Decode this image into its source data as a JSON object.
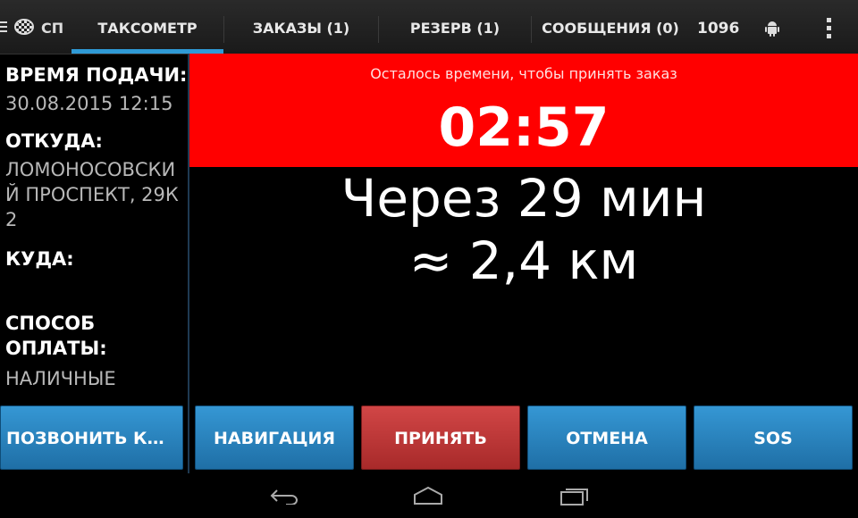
{
  "app": {
    "title": "СП"
  },
  "tabs": [
    {
      "label": "ТАКСОМЕТР",
      "active": true
    },
    {
      "label": "ЗАКАЗЫ (1)",
      "active": false
    },
    {
      "label": "РЕЗЕРВ (1)",
      "active": false
    },
    {
      "label": "СООБЩЕНИЯ (0)",
      "active": false
    }
  ],
  "counter": "1096",
  "order": {
    "pickup_time_label": "ВРЕМЯ ПОДАЧИ:",
    "pickup_time": "30.08.2015 12:15",
    "from_label": "ОТКУДА:",
    "from": "ЛОМОНОСОВСКИЙ ПРОСПЕКТ, 29К2",
    "to_label": "КУДА:",
    "to": "",
    "payment_label": "СПОСОБ ОПЛАТЫ:",
    "payment": "НАЛИЧНЫЕ"
  },
  "timer": {
    "caption": "Осталось времени, чтобы принять заказ",
    "value": "02:57"
  },
  "eta": {
    "time": "Через 29 мин",
    "distance": "≈ 2,4 км"
  },
  "buttons": {
    "call": "ПОЗВОНИТЬ КЛИЕНТУ",
    "navigation": "НАВИГАЦИЯ",
    "accept": "ПРИНЯТЬ",
    "cancel": "ОТМЕНА",
    "sos": "SOS"
  },
  "colors": {
    "timer_bg": "#ff0000",
    "button_blue": "#2680bd",
    "button_accept": "#c03838",
    "tab_indicator": "#2f9ad6"
  }
}
